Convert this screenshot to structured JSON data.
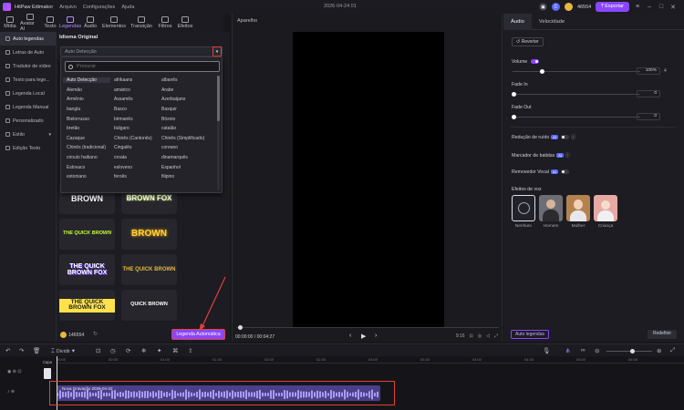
{
  "app": {
    "title": "HitPaw Edimakor",
    "menus": [
      "Arquivo",
      "Configurações",
      "Ajuda"
    ],
    "date": "2026-04-24 01",
    "credits": "46554",
    "export_label": "Exportar",
    "user_initial": "C"
  },
  "toolbar": {
    "tools": [
      "Mídia",
      "Avatar AI",
      "Texto",
      "Legendas",
      "Áudio",
      "Elementos",
      "Transição",
      "Filtros",
      "Efeitos"
    ],
    "active": "Legendas"
  },
  "sidebar": {
    "items": [
      {
        "label": "Auto legendas",
        "active": true
      },
      {
        "label": "Letras de Auto"
      },
      {
        "label": "Tradutor de vídeo"
      },
      {
        "label": "Texto para lege..."
      },
      {
        "label": "Legenda Local"
      },
      {
        "label": "Legenda Manual"
      },
      {
        "label": "Personalizado"
      },
      {
        "label": "Estilo"
      },
      {
        "label": "Edição Texto"
      }
    ]
  },
  "panel": {
    "title": "Idioma Original",
    "selected_language": "Auto Detecção",
    "search_placeholder": "Procurar",
    "dropdown_arrow": "▾",
    "languages": [
      [
        "Auto Detecção",
        "afrikaans",
        "albanês"
      ],
      [
        "Alemão",
        "amárico",
        "Árabe"
      ],
      [
        "Armênio",
        "Assamês",
        "Azerbaijano"
      ],
      [
        "bangla",
        "Basco",
        "Baxquir"
      ],
      [
        "Bielorrusso",
        "birmanês",
        "Bósnio"
      ],
      [
        "bretão",
        "búlgaro",
        "catalão"
      ],
      [
        "Cazaque",
        "Chinês (Cantonês)",
        "Chinês (Simplificado)"
      ],
      [
        "Chinês (tradicional)",
        "Cingalês",
        "coreano"
      ],
      [
        "crioulo haitiano",
        "croata",
        "dinamarquês"
      ],
      [
        "Eslovaco",
        "esloveno",
        "Espanhol"
      ],
      [
        "estoniano",
        "feroês",
        "filipino"
      ]
    ],
    "tiles": [
      "BROWN",
      "BROWN FOX",
      "THE QUICK BROWN",
      "BROWN",
      "THE QUICK BROWN FOX",
      "THE QUICK BROWN",
      "THE QUICK BROWN FOX",
      "QUICK BROWN"
    ],
    "credits_small": "146554",
    "auto_button": "Legenda Automática"
  },
  "preview": {
    "label": "Aparelho",
    "time": "00:00:00 / 00:04:27",
    "ratio": "9:16"
  },
  "right": {
    "tabs": [
      "Áudio",
      "Velocidade"
    ],
    "revert": "Reverter",
    "volume_label": "Volume",
    "volume_value": "100%",
    "volume_db": "4",
    "volume_level": 0.23,
    "fadein_label": "Fade In",
    "fadein_value": "0",
    "fadeout_label": "Fade Out",
    "fadeout_value": "0",
    "noise_label": "Redução de ruído",
    "beat_label": "Marcador de batidas",
    "vocal_label": "Removedor Vocal",
    "ai_badge": "AI",
    "voice_effects_label": "Efeitos de voz",
    "voices": [
      "Nenhum",
      "Homem",
      "Mulher",
      "Criança"
    ],
    "auto_subtitles": "Auto legendas",
    "reset": "Redefinir"
  },
  "timeline": {
    "split_label": "Dividir",
    "ruler_marks": [
      "00:00",
      "00:30",
      "01:00",
      "01:30",
      "02:00",
      "02:30",
      "03:00",
      "03:30",
      "04:00",
      "04:30",
      "05:00",
      "05:30"
    ],
    "video_clip_label": "Capa",
    "audio_clip_name": "Nova Gravação 2026-04-22"
  },
  "colors": {
    "accent": "#8a46ff",
    "highlight": "#e0403c",
    "audio_clip": "#4b3f8a"
  }
}
